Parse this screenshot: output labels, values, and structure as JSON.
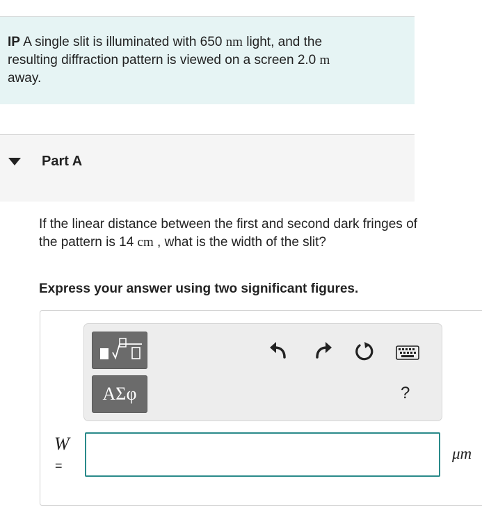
{
  "intro": {
    "label": "IP",
    "text_1": "A single slit is illuminated with 650",
    "unit_nm": "nm",
    "text_2": "light, and the",
    "text_3": "resulting diffraction pattern is viewed on a screen 2.0",
    "unit_m": "m",
    "text_4": "away."
  },
  "part": {
    "title": "Part A"
  },
  "question": {
    "text_1": "If the linear distance between the first and second dark fringes of the pattern is 14",
    "unit_cm": "cm",
    "text_2": ", what is the width of the slit?"
  },
  "instruction": "Express your answer using two significant figures.",
  "toolbar": {
    "greek_label": "ΑΣφ",
    "help_label": "?",
    "icons": [
      "template-icon",
      "undo-icon",
      "redo-icon",
      "reset-icon",
      "keyboard-icon"
    ]
  },
  "answer": {
    "variable": "W",
    "equals": "=",
    "value": "",
    "unit": "μm"
  },
  "colors": {
    "intro_bg": "#e6f4f4",
    "part_bg": "#f5f5f5",
    "tool_button": "#6b6b6b",
    "input_border": "#2a8a8a"
  }
}
